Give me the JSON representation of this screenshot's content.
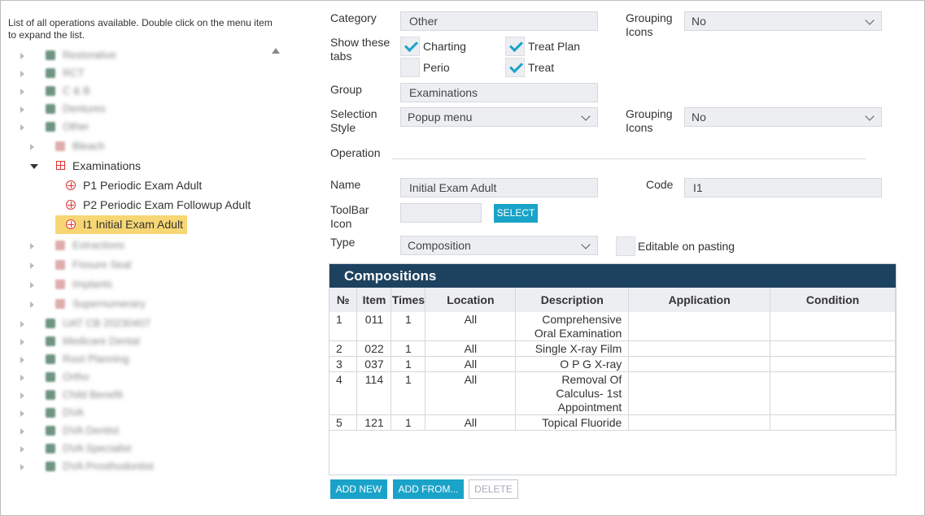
{
  "left": {
    "description": "List of all operations available. Double click on the menu item to expand the list.",
    "tree": [
      {
        "label": "Restorative",
        "blur": true
      },
      {
        "label": "RCT",
        "blur": true
      },
      {
        "label": "C & B",
        "blur": true
      },
      {
        "label": "Dentures",
        "blur": true
      },
      {
        "label": "Other",
        "blur": true
      },
      {
        "label": "Bleach",
        "blur": true
      },
      {
        "label": "Examinations",
        "blur": false
      },
      {
        "label": "P1 Periodic Exam Adult",
        "blur": false
      },
      {
        "label": "P2 Periodic Exam Followup Adult",
        "blur": false
      },
      {
        "label": "I1 Initial Exam Adult",
        "blur": false
      },
      {
        "label": "Extractions",
        "blur": true
      },
      {
        "label": "Fissure Seal",
        "blur": true
      },
      {
        "label": "Implants",
        "blur": true
      },
      {
        "label": "Supernumerary",
        "blur": true
      },
      {
        "label": "UAT CB 20230407",
        "blur": true
      },
      {
        "label": "Medicare Dental",
        "blur": true
      },
      {
        "label": "Root Planning",
        "blur": true
      },
      {
        "label": "Ortho",
        "blur": true
      },
      {
        "label": "Child Benefit",
        "blur": true
      },
      {
        "label": "DVA",
        "blur": true
      },
      {
        "label": "DVA Dentist",
        "blur": true
      },
      {
        "label": "DVA Specialist",
        "blur": true
      },
      {
        "label": "DVA Prosthodontist",
        "blur": true
      }
    ]
  },
  "form": {
    "category_label": "Category",
    "category_value": "Other",
    "grouping_icons_label": "Grouping Icons",
    "grouping_icons_value": "No",
    "show_tabs_label": "Show these tabs",
    "tabs": {
      "charting": "Charting",
      "treat_plan": "Treat Plan",
      "perio": "Perio",
      "treat": "Treat"
    },
    "group_label": "Group",
    "group_value": "Examinations",
    "selection_style_label": "Selection Style",
    "selection_style_value": "Popup menu",
    "grouping_icons2_label": "Grouping Icons",
    "grouping_icons2_value": "No",
    "operation_label": "Operation",
    "name_label": "Name",
    "name_value": "Initial Exam Adult",
    "code_label": "Code",
    "code_value": "I1",
    "toolbar_icon_label": "ToolBar Icon",
    "select_button": "SELECT",
    "type_label": "Type",
    "type_value": "Composition",
    "editable_label": "Editable on pasting"
  },
  "compositions": {
    "title": "Compositions",
    "columns": [
      "№",
      "Item",
      "Times",
      "Location",
      "Description",
      "Application",
      "Condition"
    ],
    "rows": [
      {
        "no": "1",
        "item": "011",
        "times": "1",
        "location": "All",
        "description": "Comprehensive Oral Examination",
        "application": "",
        "condition": ""
      },
      {
        "no": "2",
        "item": "022",
        "times": "1",
        "location": "All",
        "description": "Single X-ray Film",
        "application": "",
        "condition": ""
      },
      {
        "no": "3",
        "item": "037",
        "times": "1",
        "location": "All",
        "description": "O P G X-ray",
        "application": "",
        "condition": ""
      },
      {
        "no": "4",
        "item": "114",
        "times": "1",
        "location": "All",
        "description": "Removal Of Calculus- 1st Appointment",
        "application": "",
        "condition": ""
      },
      {
        "no": "5",
        "item": "121",
        "times": "1",
        "location": "All",
        "description": "Topical Fluoride",
        "application": "",
        "condition": ""
      }
    ]
  },
  "buttons": {
    "add_new": "ADD NEW",
    "add_from": "ADD FROM...",
    "delete": "DELETE"
  },
  "colors": {
    "accent": "#1aa3c8",
    "header": "#1d4260",
    "selection": "#f7d774"
  }
}
